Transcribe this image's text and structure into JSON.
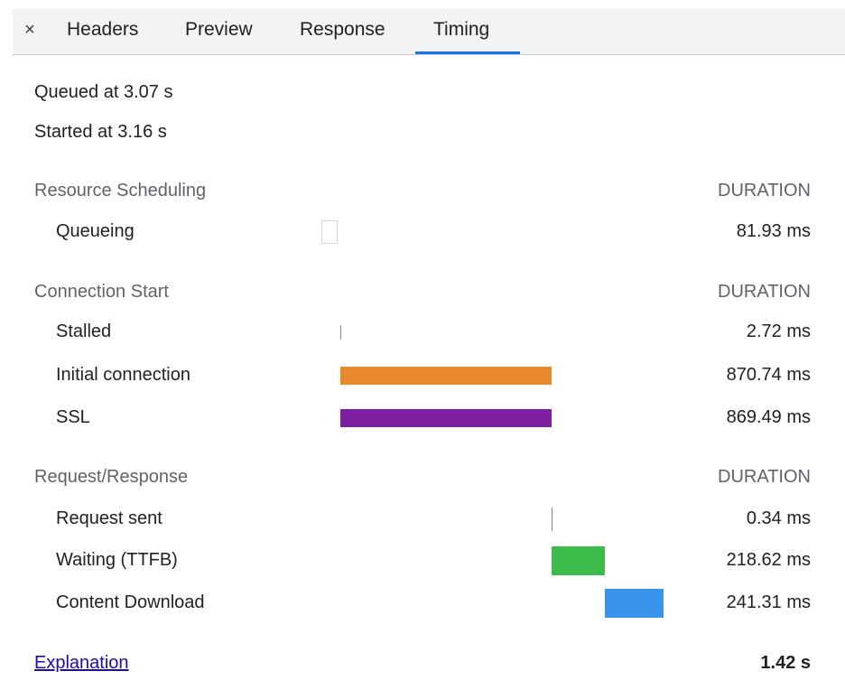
{
  "tabs": {
    "close_glyph": "×",
    "items": [
      "Headers",
      "Preview",
      "Response",
      "Timing"
    ],
    "active": "Timing"
  },
  "summary": {
    "queued": "Queued at 3.07 s",
    "started": "Started at 3.16 s"
  },
  "sections": {
    "scheduling": {
      "title": "Resource Scheduling",
      "duration_header": "DURATION",
      "rows": [
        {
          "label": "Queueing",
          "value": "81.93 ms"
        }
      ]
    },
    "connection": {
      "title": "Connection Start",
      "duration_header": "DURATION",
      "rows": [
        {
          "label": "Stalled",
          "value": "2.72 ms"
        },
        {
          "label": "Initial connection",
          "value": "870.74 ms",
          "color": "#e8892b"
        },
        {
          "label": "SSL",
          "value": "869.49 ms",
          "color": "#7e1fa1"
        }
      ]
    },
    "request": {
      "title": "Request/Response",
      "duration_header": "DURATION",
      "rows": [
        {
          "label": "Request sent",
          "value": "0.34 ms"
        },
        {
          "label": "Waiting (TTFB)",
          "value": "218.62 ms",
          "color": "#3cba4a"
        },
        {
          "label": "Content Download",
          "value": "241.31 ms",
          "color": "#3894ea"
        }
      ]
    }
  },
  "footer": {
    "explanation_link": "Explanation",
    "total": "1.42 s"
  },
  "colors": {
    "active_tab": "#1a73e8",
    "link": "#1a0dab"
  }
}
